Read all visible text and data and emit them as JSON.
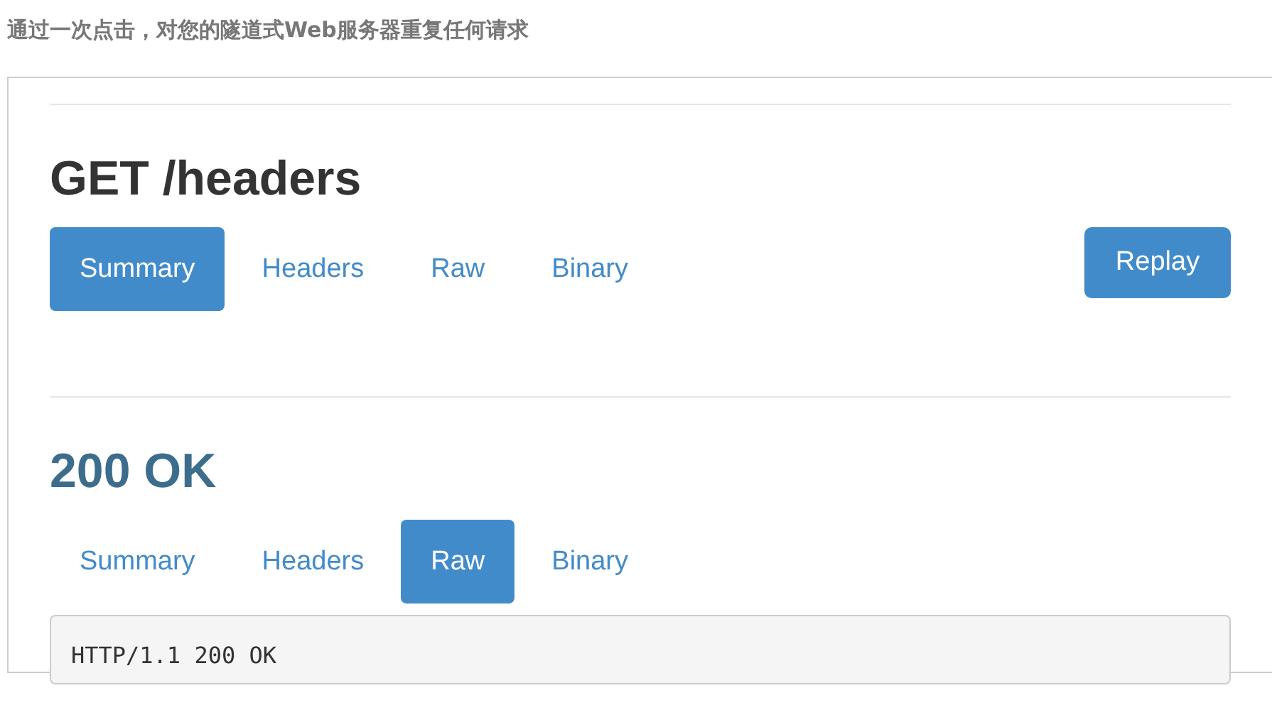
{
  "caption": "通过一次点击，对您的隧道式Web服务器重复任何请求",
  "request": {
    "title": "GET /headers",
    "tabs": [
      {
        "label": "Summary",
        "selected": true
      },
      {
        "label": "Headers",
        "selected": false
      },
      {
        "label": "Raw",
        "selected": false
      },
      {
        "label": "Binary",
        "selected": false
      }
    ],
    "replay_button": "Replay"
  },
  "response": {
    "title": "200 OK",
    "tabs": [
      {
        "label": "Summary",
        "selected": false
      },
      {
        "label": "Headers",
        "selected": false
      },
      {
        "label": "Raw",
        "selected": true
      },
      {
        "label": "Binary",
        "selected": false
      }
    ],
    "raw_lines": [
      "HTTP/1.1 200 OK"
    ]
  }
}
